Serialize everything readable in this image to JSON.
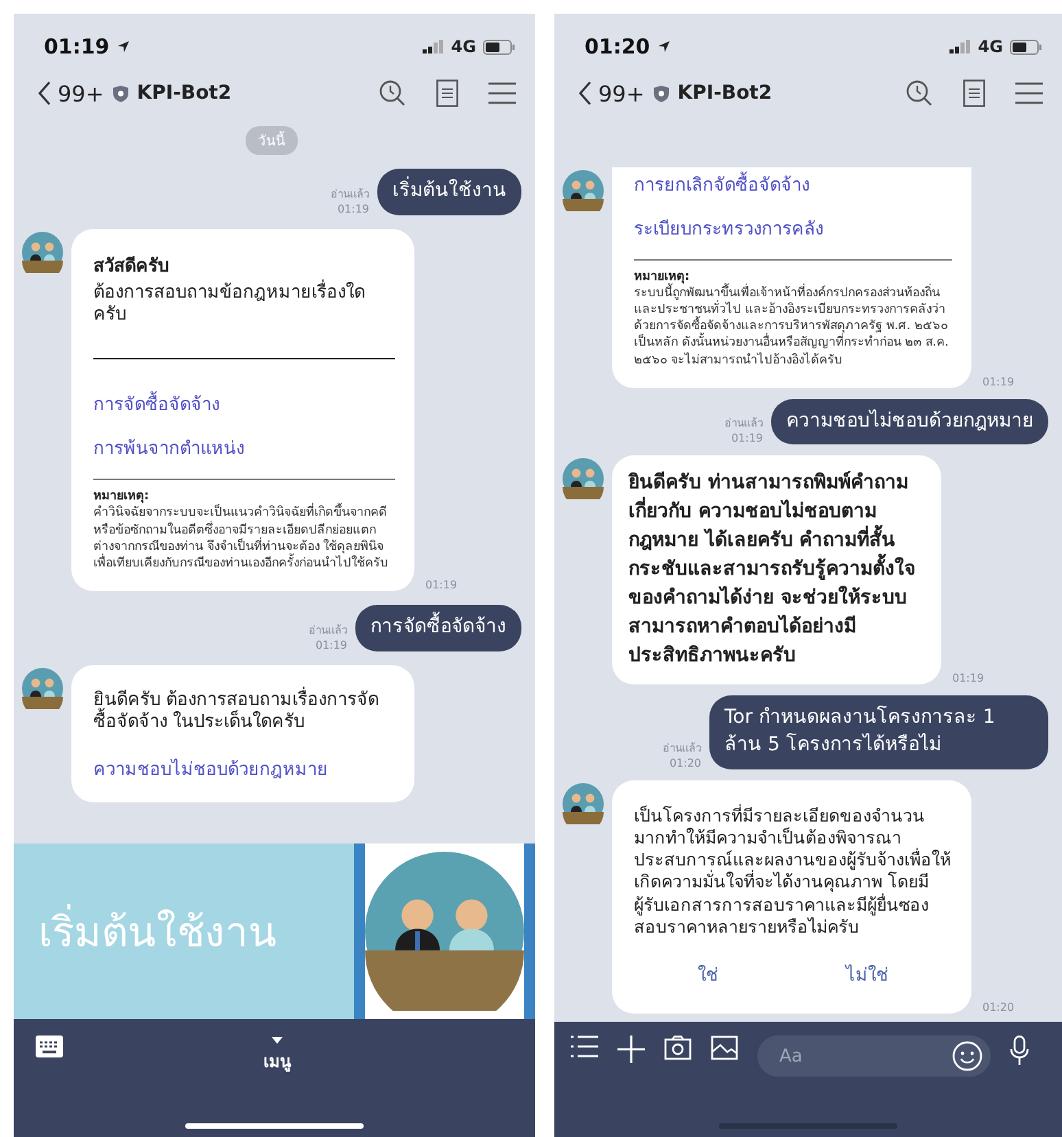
{
  "screens": [
    {
      "status_bar": {
        "time": "01:19",
        "network": "4G"
      },
      "header": {
        "back_count": "99+",
        "title": "KPI-Bot2"
      },
      "date_chip": "วันนี้",
      "messages": [
        {
          "kind": "sent",
          "read": "อ่านแล้ว",
          "time": "01:19",
          "text": "เริ่มต้นใช้งาน"
        },
        {
          "kind": "card",
          "title": "สวัสดีครับ",
          "text": "ต้องการสอบถามข้อกฎหมายเรื่องใด ครับ",
          "links": [
            "การจัดซื้อจัดจ้าง",
            "การพ้นจากตำแหน่ง"
          ],
          "note_title": "หมายเหตุ:",
          "note": "คำวินิจฉัยจากระบบจะเป็นแนวคำวินิจฉัยที่เกิดขึ้นจากคดีหรือข้อซักถามในอดีตซึ่งอาจมีรายละเอียดปลีกย่อยแตกต่างจากกรณีของท่าน จึงจำเป็นที่ท่านจะต้อง ใช้ดุลยพินิจเพื่อเทียบเคียงกับกรณีของท่านเองอีกครั้งก่อนนำไปใช้ครับ",
          "time": "01:19"
        },
        {
          "kind": "sent",
          "read": "อ่านแล้ว",
          "time": "01:19",
          "text": "การจัดซื้อจัดจ้าง"
        },
        {
          "kind": "card",
          "text": "ยินดีครับ ต้องการสอบถามเรื่องการจัดซื้อจัดจ้าง ในประเด็นใดครับ",
          "links": [
            "ความชอบไม่ชอบด้วยกฎหมาย"
          ]
        }
      ],
      "footer": {
        "kind": "rich_menu",
        "banner_text": "เริ่มต้นใช้งาน",
        "menu_label": "เมนู"
      }
    },
    {
      "status_bar": {
        "time": "01:20",
        "network": "4G"
      },
      "header": {
        "back_count": "99+",
        "title": "KPI-Bot2"
      },
      "messages": [
        {
          "kind": "card",
          "links": [
            "การยกเลิกจัดซื้อจัดจ้าง",
            "ระเบียบกระทรวงการคลัง"
          ],
          "note_title": "หมายเหตุ:",
          "note": "ระบบนี้ถูกพัฒนาขึ้นเพื่อเจ้าหน้าที่องค์กรปกครองส่วนท้องถิ่นและประชาชนทั่วไป และอ้างอิงระเบียบกระทรวงการคลังว่าด้วยการจัดซื้อจัดจ้างและการบริหารพัสดุภาครัฐ พ.ศ. ๒๕๖๐ เป็นหลัก ดังนั้นหน่วยงานอื่นหรือสัญญาที่กระทำก่อน ๒๓ ส.ค. ๒๕๖๐ จะไม่สามารถนำไปอ้างอิงได้ครับ",
          "time": "01:19"
        },
        {
          "kind": "sent",
          "read": "อ่านแล้ว",
          "time": "01:19",
          "text": "ความชอบไม่ชอบด้วยกฎหมาย"
        },
        {
          "kind": "bubble",
          "text": "ยินดีครับ ท่านสามารถพิมพ์คำถามเกี่ยวกับ ความชอบไม่ชอบตามกฎหมาย ได้เลยครับ คำถามที่สั้นกระชับและสามารถรับรู้ความตั้งใจของคำถามได้ง่าย จะช่วยให้ระบบสามารถหาคำตอบได้อย่างมีประสิทธิภาพนะครับ",
          "time": "01:19"
        },
        {
          "kind": "sent",
          "read": "อ่านแล้ว",
          "time": "01:20",
          "text": "Tor กำหนดผลงานโครงการละ 1 ล้าน 5 โครงการได้หรือไม่"
        },
        {
          "kind": "card",
          "text": "เป็นโครงการที่มีรายละเอียดของจำนวนมากทำให้มีความจำเป็นต้องพิจารณาประสบการณ์และผลงานของผู้รับจ้างเพื่อให้เกิดความมั่นใจที่จะได้งานคุณภาพ โดยมีผู้รับเอกสารการสอบราคาและมีผู้ยื่นซองสอบราคาหลายรายหรือไม่ครับ",
          "buttons": [
            "ใช่",
            "ไม่ใช่"
          ],
          "time": "01:20"
        }
      ],
      "footer": {
        "kind": "input",
        "placeholder": "Aa"
      }
    }
  ]
}
